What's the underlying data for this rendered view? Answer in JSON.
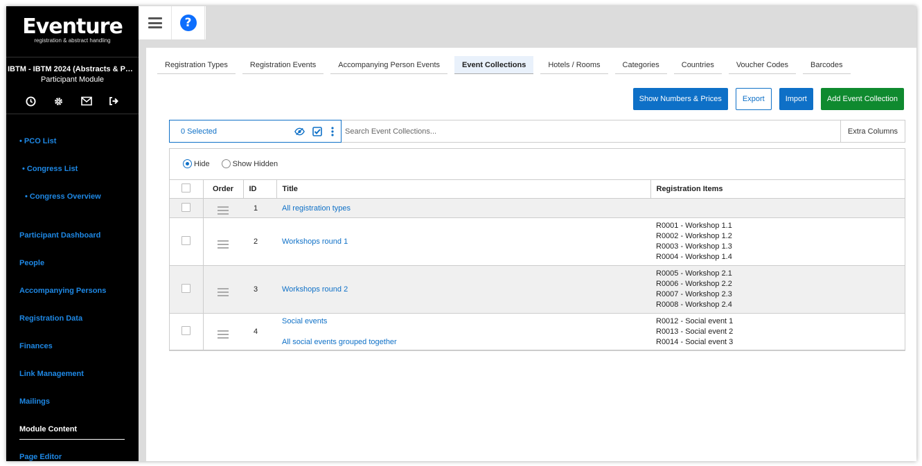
{
  "sidebar": {
    "logo_title": "Eventure",
    "logo_subtitle": "registration & abstract handling",
    "congress_title": "IBTM - IBTM 2024 (Abstracts & Participants)",
    "module_name": "Participant Module",
    "icons": [
      "clock-icon",
      "gear-icon",
      "mail-icon",
      "logout-icon"
    ],
    "sub_nav": [
      "• PCO List",
      "• Congress List",
      "• Congress Overview"
    ],
    "nav": [
      "Participant Dashboard",
      "People",
      "Accompanying Persons",
      "Registration Data",
      "Finances",
      "Link Management",
      "Mailings",
      "Module Content",
      "Page Editor"
    ],
    "active_nav": "Module Content"
  },
  "tabs": [
    "Registration Types",
    "Registration Events",
    "Accompanying Person Events",
    "Event Collections",
    "Hotels / Rooms",
    "Categories",
    "Countries",
    "Voucher Codes",
    "Barcodes"
  ],
  "active_tab": "Event Collections",
  "actions": {
    "show_numbers": "Show Numbers & Prices",
    "export": "Export",
    "import": "Import",
    "add": "Add Event Collection"
  },
  "toolbar": {
    "selected": "0 Selected",
    "search_placeholder": "Search Event Collections...",
    "extra_columns": "Extra Columns"
  },
  "filter": {
    "hide": "Hide",
    "show_hidden": "Show Hidden",
    "selected": "Hide"
  },
  "table": {
    "headers": {
      "order": "Order",
      "id": "ID",
      "title": "Title",
      "items": "Registration Items"
    },
    "rows": [
      {
        "id": "1",
        "title": "All registration types",
        "subtitle": "",
        "items": []
      },
      {
        "id": "2",
        "title": "Workshops round 1",
        "subtitle": "",
        "items": [
          "R0001 - Workshop 1.1",
          "R0002 - Workshop 1.2",
          "R0003 - Workshop 1.3",
          "R0004 - Workshop 1.4"
        ]
      },
      {
        "id": "3",
        "title": "Workshops round 2",
        "subtitle": "",
        "items": [
          "R0005 - Workshop 2.1",
          "R0006 - Workshop 2.2",
          "R0007 - Workshop 2.3",
          "R0008 - Workshop 2.4"
        ]
      },
      {
        "id": "4",
        "title": "Social events",
        "subtitle": "All social events grouped together",
        "items": [
          "R0012 - Social event 1",
          "R0013 - Social event 2",
          "R0014 - Social event 3"
        ]
      }
    ]
  },
  "colors": {
    "accent": "#0e70c7",
    "success": "#0f8a2f",
    "sidebar_bg": "#000000",
    "nav_link": "#1e88e5"
  }
}
